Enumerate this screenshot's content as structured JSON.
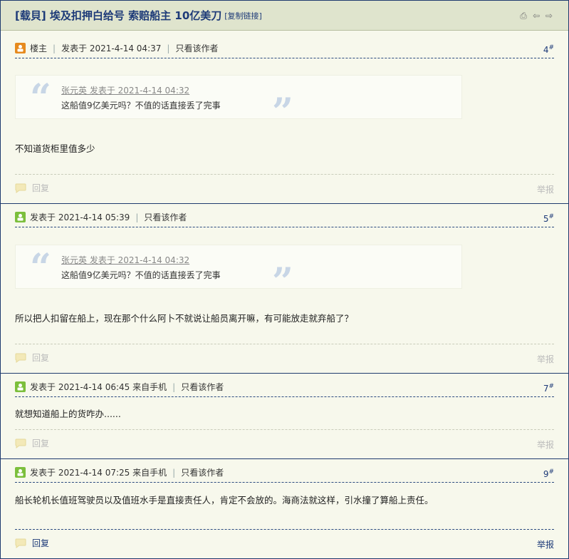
{
  "thread": {
    "title": "[载貝] 埃及扣押白给号 索赔船主 10亿美刀",
    "copy_link": "[复制链接]"
  },
  "labels": {
    "reply": "回复",
    "report": "举报",
    "only_author": "只看该作者",
    "op": "楼主"
  },
  "posts": [
    {
      "op": "楼主",
      "posted": "发表于 2021-4-14 04:37",
      "floor": "4",
      "quote": {
        "author_line": "张元英 发表于 2021-4-14 04:32",
        "text": "这船值9亿美元吗？不值的话直接丢了完事"
      },
      "body": "不知道货柜里值多少"
    },
    {
      "posted": "发表于 2021-4-14 05:39",
      "floor": "5",
      "quote": {
        "author_line": "张元英 发表于 2021-4-14 04:32",
        "text": "这船值9亿美元吗？不值的话直接丢了完事"
      },
      "body": "所以把人扣留在船上，现在那个什么阿卜不就说让船员离开嘛，有可能放走就弃船了？"
    },
    {
      "posted": "发表于 2021-4-14 06:45 来自手机",
      "floor": "7",
      "body": "就想知道船上的货咋办......"
    },
    {
      "posted": "发表于 2021-4-14 07:25 来自手机",
      "floor": "9",
      "body": "船长轮机长值班驾驶员以及值班水手是直接责任人，肯定不会放的。海商法就这样，引水撞了算船上责任。"
    }
  ],
  "floor_mark": "#",
  "icons": [
    "print-icon",
    "prev-thread-icon",
    "next-thread-icon",
    "op-badge-icon",
    "user-badge-icon",
    "reply-icon"
  ],
  "colors": {
    "accent": "#1d3a78",
    "header_bg": "#dfe4cd",
    "page_bg": "#f7f8ec",
    "op_badge": "#e68a1e",
    "user_badge": "#7cbf3c"
  }
}
